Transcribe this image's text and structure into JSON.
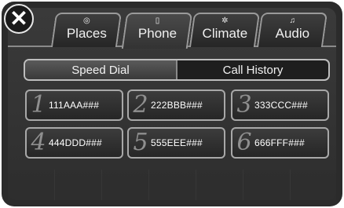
{
  "close": {
    "icon": "close-icon",
    "glyph": "✕"
  },
  "tabs": [
    {
      "label": "Places",
      "icon": "places-icon",
      "glyph": "◎"
    },
    {
      "label": "Phone",
      "icon": "phone-icon",
      "glyph": "▯"
    },
    {
      "label": "Climate",
      "icon": "fan-icon",
      "glyph": "✲"
    },
    {
      "label": "Audio",
      "icon": "music-note-icon",
      "glyph": "♫"
    }
  ],
  "active_tab": "Phone",
  "segments": [
    {
      "label": "Speed Dial"
    },
    {
      "label": "Call History"
    }
  ],
  "active_segment": "Speed Dial",
  "speed_dial": [
    {
      "number": "1",
      "label": "111AAA###"
    },
    {
      "number": "2",
      "label": "222BBB###"
    },
    {
      "number": "3",
      "label": "333CCC###"
    },
    {
      "number": "4",
      "label": "444DDD###"
    },
    {
      "number": "5",
      "label": "555EEE###"
    },
    {
      "number": "6",
      "label": "666FFF###"
    }
  ]
}
